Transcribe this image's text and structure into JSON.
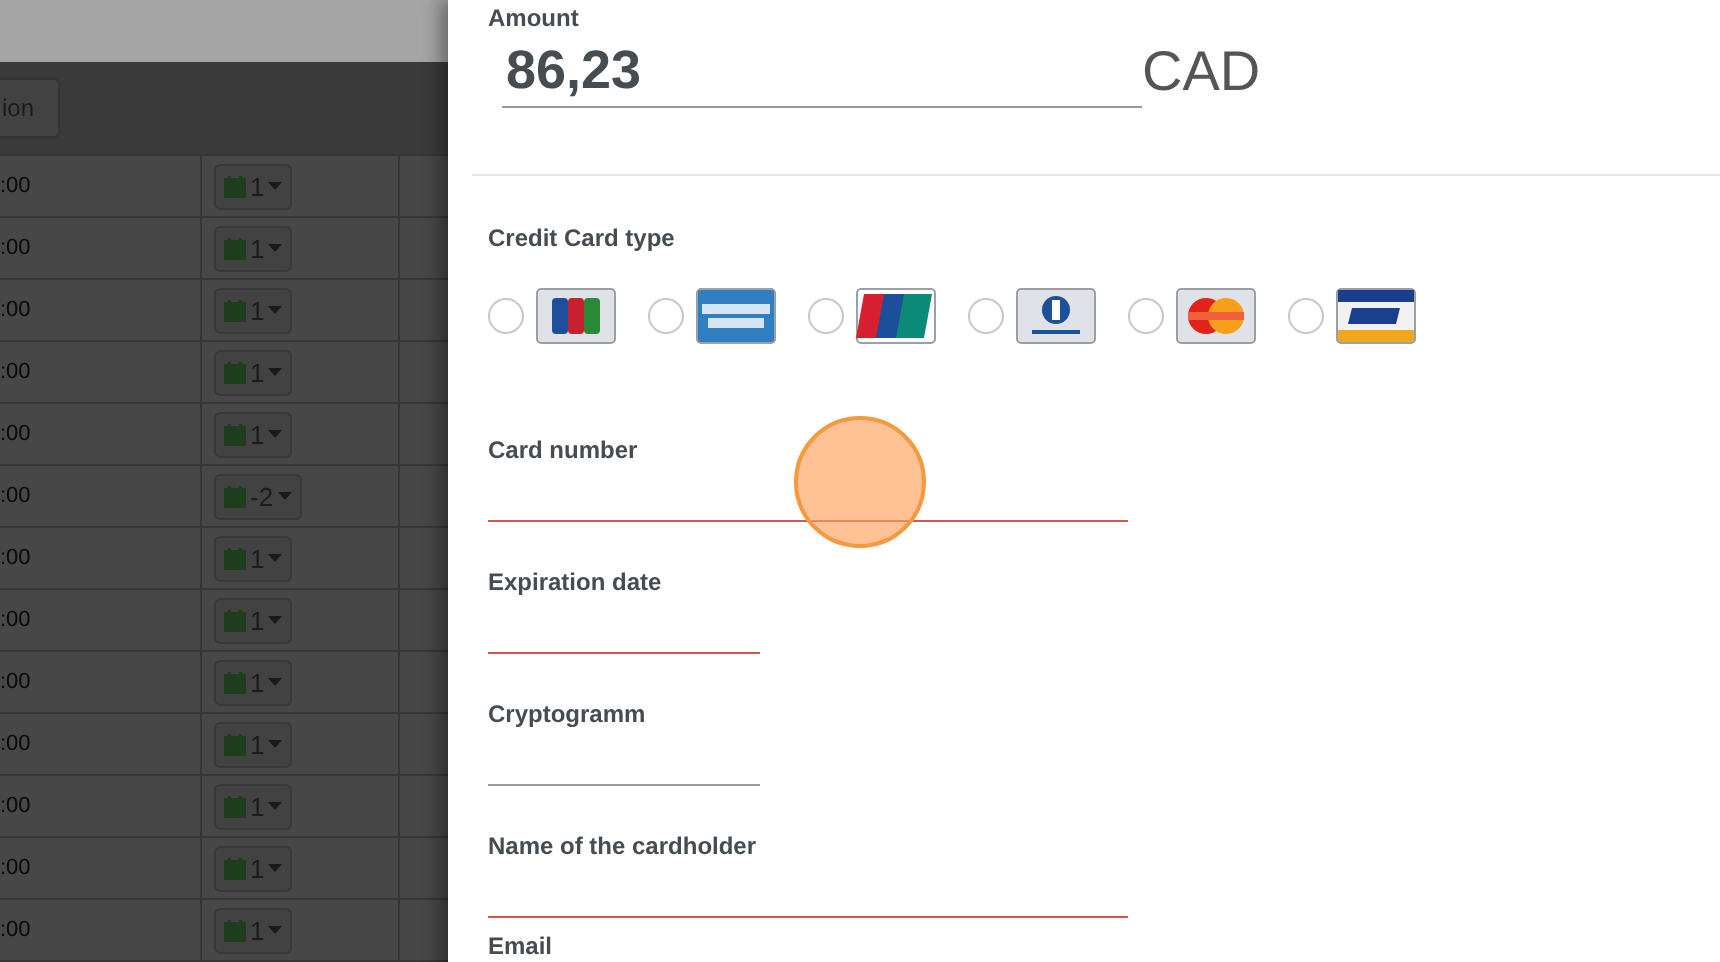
{
  "background_table": {
    "header_button": "ion",
    "rows": [
      {
        "time": ":00",
        "day": "1"
      },
      {
        "time": ":00",
        "day": "1"
      },
      {
        "time": ":00",
        "day": "1"
      },
      {
        "time": ":00",
        "day": "1"
      },
      {
        "time": ":00",
        "day": "1"
      },
      {
        "time": ":00",
        "day": "-2"
      },
      {
        "time": ":00",
        "day": "1"
      },
      {
        "time": ":00",
        "day": "1"
      },
      {
        "time": ":00",
        "day": "1"
      },
      {
        "time": ":00",
        "day": "1"
      },
      {
        "time": ":00",
        "day": "1"
      },
      {
        "time": ":00",
        "day": "1"
      },
      {
        "time": ":00",
        "day": "1"
      }
    ]
  },
  "payment_panel": {
    "amount": {
      "label": "Amount",
      "value": "86,23",
      "currency": "CAD"
    },
    "card_type": {
      "label": "Credit Card type",
      "options": [
        {
          "kind": "jcb",
          "selected": false
        },
        {
          "kind": "amex",
          "selected": false
        },
        {
          "kind": "unionpay",
          "selected": false
        },
        {
          "kind": "diners",
          "selected": false
        },
        {
          "kind": "mastercard",
          "selected": false
        },
        {
          "kind": "visa",
          "selected": false
        }
      ]
    },
    "fields": [
      {
        "label": "Card number",
        "kind": "long",
        "invalid": true
      },
      {
        "label": "Expiration date",
        "kind": "short",
        "invalid": true
      },
      {
        "label": "Cryptogramm",
        "kind": "short",
        "invalid": false
      },
      {
        "label": "Name of the cardholder",
        "kind": "long",
        "invalid": true
      },
      {
        "label": "Email",
        "kind": "cut"
      }
    ]
  }
}
